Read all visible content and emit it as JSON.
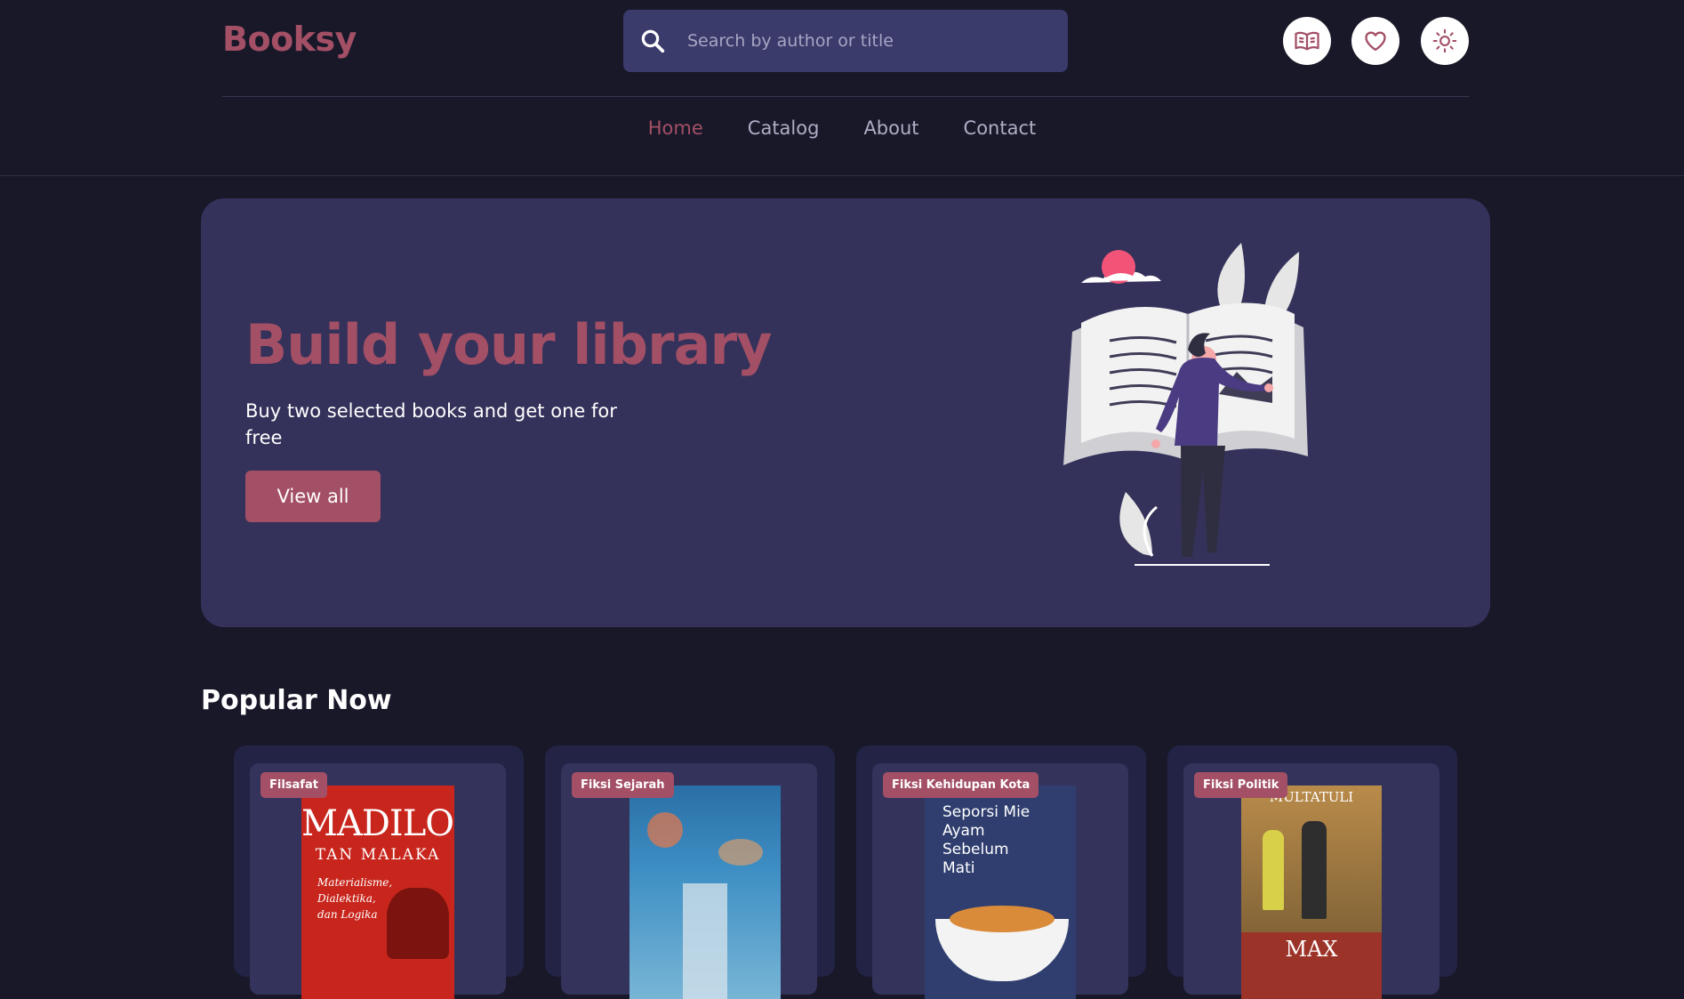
{
  "header": {
    "logo": "Booksy",
    "search_placeholder": "Search by author or title",
    "icons": [
      "book-open-icon",
      "heart-icon",
      "sun-icon"
    ]
  },
  "nav": {
    "items": [
      "Home",
      "Catalog",
      "About",
      "Contact"
    ],
    "active": "Home"
  },
  "hero": {
    "title": "Build your library",
    "subtitle": "Buy two selected books and get one for free",
    "button": "View all"
  },
  "popular": {
    "title": "Popular Now",
    "books": [
      {
        "tag": "Filsafat",
        "cover_title": "MADILOG",
        "cover_author": "TAN MALAKA",
        "cover_subtitle": "Materialisme, Dialektika, dan Logika"
      },
      {
        "tag": "Fiksi Sejarah"
      },
      {
        "tag": "Fiksi Kehidupan Kota",
        "cover_title": "Seporsi Mie Ayam Sebelum Mati"
      },
      {
        "tag": "Fiksi Politik",
        "cover_author": "MULTATULI",
        "cover_title": "MAX"
      }
    ]
  },
  "colors": {
    "background": "#181829",
    "accent": "#a34f65",
    "panel": "#34325a",
    "search_bg": "#3a3a6b"
  }
}
